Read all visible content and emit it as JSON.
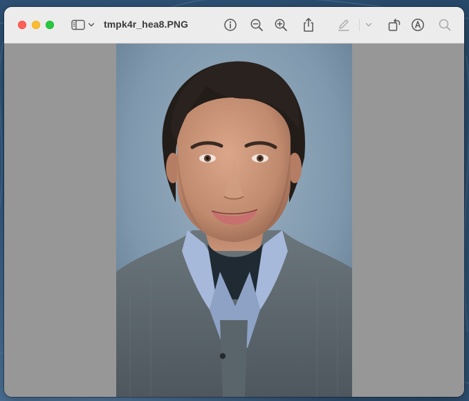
{
  "window": {
    "title": "tmpk4r_hea8.PNG"
  },
  "toolbar": {
    "sidebar_toggle_icon": "sidebar-icon",
    "sidebar_menu_icon": "chevron-down-icon",
    "info_icon": "info-circle-icon",
    "zoom_out_icon": "zoom-out-icon",
    "zoom_in_icon": "zoom-in-icon",
    "share_icon": "share-icon",
    "markup_icon": "pencil-icon",
    "markup_menu_icon": "chevron-down-icon",
    "rotate_icon": "rotate-icon",
    "annotate_icon": "markup-circle-icon",
    "search_icon": "search-icon"
  },
  "colors": {
    "close": "#fe5f57",
    "minimize": "#febc2e",
    "maximize": "#28c840",
    "titlebar": "#ececec",
    "canvas": "#979797",
    "photo_background": "#7e98ae",
    "sweater": "#5e6a71",
    "shirt": "#9fb3d6",
    "hair": "#231d1a",
    "skin": "#c89276"
  }
}
